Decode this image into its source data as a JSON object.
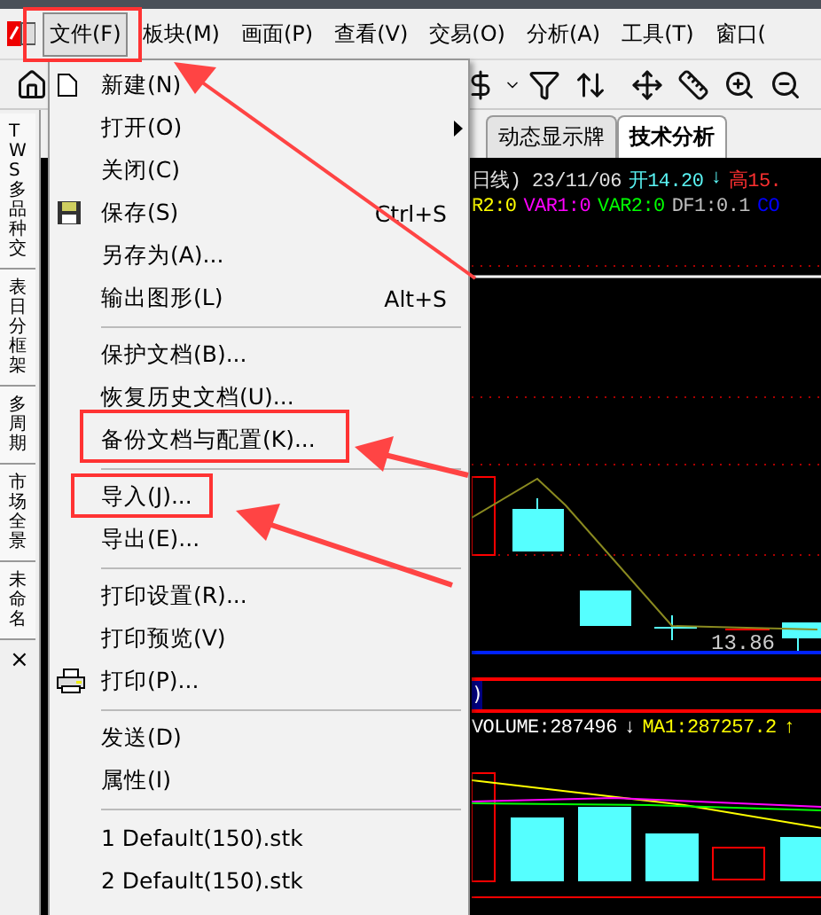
{
  "menu_bar": [
    {
      "label": "文件(F)",
      "selected": true
    },
    {
      "label": "板块(M)",
      "selected": false
    },
    {
      "label": "画面(P)",
      "selected": false
    },
    {
      "label": "查看(V)",
      "selected": false
    },
    {
      "label": "交易(O)",
      "selected": false
    },
    {
      "label": "分析(A)",
      "selected": false
    },
    {
      "label": "工具(T)",
      "selected": false
    },
    {
      "label": "窗口(",
      "selected": false
    }
  ],
  "side_tabs": [
    {
      "label": "TWS多品种交"
    },
    {
      "label": "表日分框架"
    },
    {
      "label": "多周期"
    },
    {
      "label": "市场全景"
    },
    {
      "label": "未命名"
    }
  ],
  "side_close": "×",
  "file_menu": [
    {
      "kind": "item",
      "label": "新建(N)"
    },
    {
      "kind": "item",
      "label": "打开(O)",
      "submenu": true
    },
    {
      "kind": "item",
      "label": "关闭(C)"
    },
    {
      "kind": "item",
      "label": "保存(S)",
      "shortcut": "Ctrl+S"
    },
    {
      "kind": "item",
      "label": "另存为(A)..."
    },
    {
      "kind": "item",
      "label": "输出图形(L)",
      "shortcut": "Alt+S"
    },
    {
      "kind": "separator"
    },
    {
      "kind": "item",
      "label": "保护文档(B)..."
    },
    {
      "kind": "item",
      "label": "恢复历史文档(U)..."
    },
    {
      "kind": "item",
      "label": "备份文档与配置(K)..."
    },
    {
      "kind": "separator"
    },
    {
      "kind": "item",
      "label": "导入(J)..."
    },
    {
      "kind": "item",
      "label": "导出(E)..."
    },
    {
      "kind": "separator"
    },
    {
      "kind": "item",
      "label": "打印设置(R)..."
    },
    {
      "kind": "item",
      "label": "打印预览(V)"
    },
    {
      "kind": "item",
      "label": "打印(P)..."
    },
    {
      "kind": "separator"
    },
    {
      "kind": "item",
      "label": "发送(D)"
    },
    {
      "kind": "item",
      "label": "属性(I)"
    },
    {
      "kind": "separator"
    },
    {
      "kind": "item",
      "label": "1 Default(150).stk"
    },
    {
      "kind": "item",
      "label": "2 Default(150).stk"
    }
  ],
  "chart_tabs": [
    {
      "label": "动态显示牌",
      "selected": false
    },
    {
      "label": "技术分析",
      "selected": true
    }
  ],
  "price_info": [
    {
      "text": "日线) 23/11/06",
      "color": "#e0e0e0"
    },
    {
      "text": "开14.20",
      "color": "#5af5f5"
    },
    {
      "text": "↓",
      "color": "#5af5f5"
    },
    {
      "text": "高15.",
      "color": "#ff3030"
    }
  ],
  "indicators": [
    {
      "text": "R2:0",
      "color": "#ffff00"
    },
    {
      "text": "VAR1:0",
      "color": "#ff00ff"
    },
    {
      "text": "VAR2:0",
      "color": "#00ff00"
    },
    {
      "text": "DF1:0.1",
      "color": "#c0c0c0"
    },
    {
      "text": "CO",
      "color": "#0000ff"
    }
  ],
  "low_label": "13.86",
  "panel_marker": ")",
  "volume_info": [
    {
      "text": "VOLUME:287496",
      "color": "#ffffff"
    },
    {
      "text": "↓",
      "color": "#ffffff"
    },
    {
      "text": "MA1:287257.2",
      "color": "#ffff00"
    },
    {
      "text": "↑",
      "color": "#ffff00"
    }
  ]
}
